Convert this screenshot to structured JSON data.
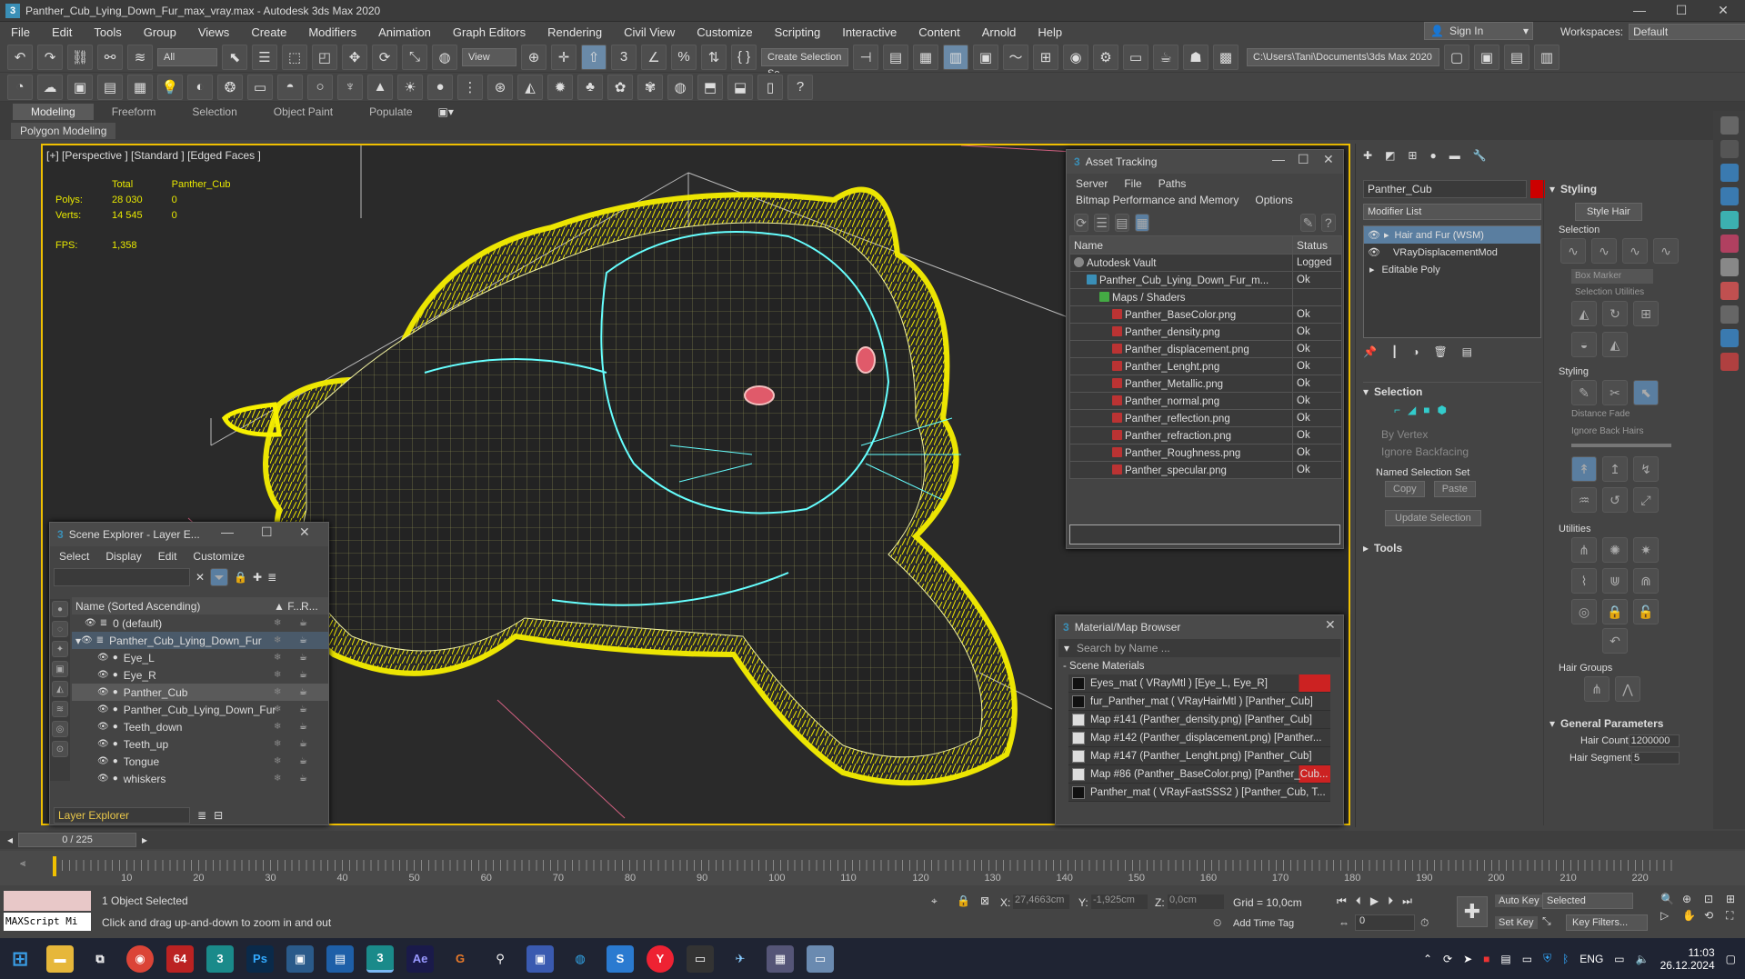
{
  "window": {
    "title": "Panther_Cub_Lying_Down_Fur_max_vray.max - Autodesk 3ds Max 2020",
    "min": "—",
    "max": "☐",
    "close": "✕"
  },
  "menu": [
    "File",
    "Edit",
    "Tools",
    "Group",
    "Views",
    "Create",
    "Modifiers",
    "Animation",
    "Graph Editors",
    "Rendering",
    "Civil View",
    "Customize",
    "Scripting",
    "Interactive",
    "Content",
    "Arnold",
    "Help"
  ],
  "signin": "Sign In",
  "workspaces_label": "Workspaces:",
  "workspace": "Default",
  "toolbar": {
    "filter": "All",
    "view": "View",
    "selection_set": "Create Selection Se",
    "path": "C:\\Users\\Tani\\Documents\\3ds Max 2020"
  },
  "ribbon": {
    "tabs": [
      "Modeling",
      "Freeform",
      "Selection",
      "Object Paint",
      "Populate"
    ],
    "sub": "Polygon Modeling"
  },
  "viewport": {
    "label": "[+] [Perspective ] [Standard ] [Edged Faces ]",
    "stats": {
      "total": "Total",
      "obj": "Panther_Cub",
      "polys_l": "Polys:",
      "polys_t": "28 030",
      "polys_o": "0",
      "verts_l": "Verts:",
      "verts_t": "14 545",
      "verts_o": "0",
      "fps_l": "FPS:",
      "fps_v": "1,358"
    }
  },
  "asset": {
    "title": "Asset Tracking",
    "menu1": [
      "Server",
      "File",
      "Paths"
    ],
    "menu2": [
      "Bitmap Performance and Memory",
      "Options"
    ],
    "col_name": "Name",
    "col_status": "Status",
    "rows": [
      {
        "n": "Autodesk Vault",
        "s": "Logged",
        "lvl": 1
      },
      {
        "n": "Panther_Cub_Lying_Down_Fur_m...",
        "s": "Ok",
        "lvl": 2
      },
      {
        "n": "Maps / Shaders",
        "s": "",
        "lvl": 3
      },
      {
        "n": "Panther_BaseColor.png",
        "s": "Ok",
        "lvl": 4
      },
      {
        "n": "Panther_density.png",
        "s": "Ok",
        "lvl": 4
      },
      {
        "n": "Panther_displacement.png",
        "s": "Ok",
        "lvl": 4
      },
      {
        "n": "Panther_Lenght.png",
        "s": "Ok",
        "lvl": 4
      },
      {
        "n": "Panther_Metallic.png",
        "s": "Ok",
        "lvl": 4
      },
      {
        "n": "Panther_normal.png",
        "s": "Ok",
        "lvl": 4
      },
      {
        "n": "Panther_reflection.png",
        "s": "Ok",
        "lvl": 4
      },
      {
        "n": "Panther_refraction.png",
        "s": "Ok",
        "lvl": 4
      },
      {
        "n": "Panther_Roughness.png",
        "s": "Ok",
        "lvl": 4
      },
      {
        "n": "Panther_specular.png",
        "s": "Ok",
        "lvl": 4
      }
    ]
  },
  "scene": {
    "title": "Scene Explorer - Layer E...",
    "menu": [
      "Select",
      "Display",
      "Edit",
      "Customize"
    ],
    "header": "Name (Sorted Ascending)",
    "hf": "▲ F...",
    "hr": "R...",
    "items": [
      {
        "n": "0 (default)",
        "lvl": 0
      },
      {
        "n": "Panther_Cub_Lying_Down_Fur",
        "lvl": 0
      },
      {
        "n": "Eye_L",
        "lvl": 1
      },
      {
        "n": "Eye_R",
        "lvl": 1
      },
      {
        "n": "Panther_Cub",
        "lvl": 1
      },
      {
        "n": "Panther_Cub_Lying_Down_Fur",
        "lvl": 1
      },
      {
        "n": "Teeth_down",
        "lvl": 1
      },
      {
        "n": "Teeth_up",
        "lvl": 1
      },
      {
        "n": "Tongue",
        "lvl": 1
      },
      {
        "n": "whiskers",
        "lvl": 1
      }
    ],
    "footer": "Layer Explorer"
  },
  "matbrowser": {
    "title": "Material/Map Browser",
    "search": "Search by Name ...",
    "section": "- Scene Materials",
    "items": [
      "Eyes_mat  ( VRayMtl ) [Eye_L, Eye_R]",
      "fur_Panther_mat  ( VRayHairMtl ) [Panther_Cub]",
      "Map #141 (Panther_density.png) [Panther_Cub]",
      "Map #142 (Panther_displacement.png) [Panther...",
      "Map #147 (Panther_Lenght.png) [Panther_Cub]",
      "Map #86 (Panther_BaseColor.png) [Panther_Cub...",
      "Panther_mat  ( VRayFastSSS2 ) [Panther_Cub, T..."
    ]
  },
  "cmd": {
    "obj": "Panther_Cub",
    "modlist": "Modifier List",
    "stack": [
      "Hair and Fur (WSM)",
      "VRayDisplacementMod",
      "Editable Poly"
    ],
    "selection": "Selection",
    "by_vertex": "By Vertex",
    "ignore_bf": "Ignore Backfacing",
    "named_sel": "Named Selection Set",
    "copy": "Copy",
    "paste": "Paste",
    "update": "Update Selection",
    "tools": "Tools",
    "styling": "Styling",
    "style_hair": "Style Hair",
    "sel2": "Selection",
    "box_marker": "Box Marker",
    "sel_util": "Selection Utilities",
    "styling2": "Styling",
    "dist_fade": "Distance Fade",
    "ign_back": "Ignore Back Hairs",
    "utilities": "Utilities",
    "hair_groups": "Hair Groups",
    "gen_params": "General Parameters",
    "hair_count_l": "Hair Count",
    "hair_count": "1200000",
    "hair_seg_l": "Hair Segments",
    "hair_seg": "5"
  },
  "timeline": {
    "frame": "0 / 225",
    "ticks": [
      "10",
      "20",
      "30",
      "40",
      "50",
      "60",
      "70",
      "80",
      "90",
      "100",
      "110",
      "120",
      "130",
      "140",
      "150",
      "160",
      "170",
      "180",
      "190",
      "200",
      "210",
      "220"
    ]
  },
  "status": {
    "selected": "1 Object Selected",
    "hint": "Click and drag up-and-down to zoom in and out",
    "maxscript": "MAXScript Mi",
    "x_l": "X:",
    "x": "27,4663cm",
    "y_l": "Y:",
    "y": "-1,925cm",
    "z_l": "Z:",
    "z": "0,0cm",
    "grid": "Grid = 10,0cm",
    "addtag": "Add Time Tag",
    "autokey": "Auto Key",
    "setkey": "Set Key",
    "sel_dd": "Selected",
    "keyfilters": "Key Filters...",
    "frame": "0"
  },
  "taskbar": {
    "lang": "ENG",
    "time": "11:03",
    "date": "26.12.2024"
  }
}
